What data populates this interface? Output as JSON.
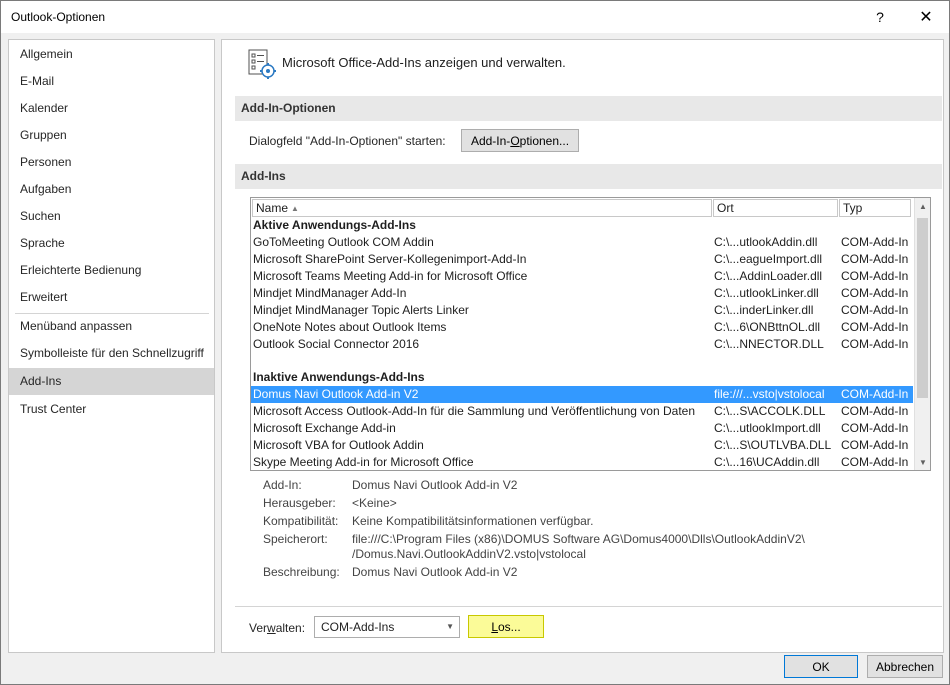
{
  "window": {
    "title": "Outlook-Optionen",
    "help_glyph": "?",
    "close_glyph": "✕"
  },
  "sidebar": {
    "items": [
      {
        "label": "Allgemein"
      },
      {
        "label": "E-Mail"
      },
      {
        "label": "Kalender"
      },
      {
        "label": "Gruppen"
      },
      {
        "label": "Personen"
      },
      {
        "label": "Aufgaben"
      },
      {
        "label": "Suchen"
      },
      {
        "label": "Sprache"
      },
      {
        "label": "Erleichterte Bedienung"
      },
      {
        "label": "Erweitert"
      },
      {
        "label": "Menüband anpassen"
      },
      {
        "label": "Symbolleiste für den Schnellzugriff"
      },
      {
        "label": "Add-Ins",
        "selected": true
      },
      {
        "label": "Trust Center"
      }
    ]
  },
  "main": {
    "header": "Microsoft Office-Add-Ins anzeigen und verwalten.",
    "addin_options_section": "Add-In-Optionen",
    "addin_options_label": "Dialogfeld \"Add-In-Optionen\" starten:",
    "addin_options_button_pre": "Add-In-",
    "addin_options_button_u": "O",
    "addin_options_button_post": "ptionen...",
    "addins_section": "Add-Ins"
  },
  "list": {
    "columns": {
      "name": "Name",
      "ort": "Ort",
      "typ": "Typ"
    },
    "active_group": "Aktive Anwendungs-Add-Ins",
    "active": [
      {
        "name": "GoToMeeting Outlook COM Addin",
        "ort": "C:\\...utlookAddin.dll",
        "typ": "COM-Add-In"
      },
      {
        "name": "Microsoft SharePoint Server-Kollegenimport-Add-In",
        "ort": "C:\\...eagueImport.dll",
        "typ": "COM-Add-In"
      },
      {
        "name": "Microsoft Teams Meeting Add-in for Microsoft Office",
        "ort": "C:\\...AddinLoader.dll",
        "typ": "COM-Add-In"
      },
      {
        "name": "Mindjet MindManager Add-In",
        "ort": "C:\\...utlookLinker.dll",
        "typ": "COM-Add-In"
      },
      {
        "name": "Mindjet MindManager Topic Alerts Linker",
        "ort": "C:\\...inderLinker.dll",
        "typ": "COM-Add-In"
      },
      {
        "name": "OneNote Notes about Outlook Items",
        "ort": "C:\\...6\\ONBttnOL.dll",
        "typ": "COM-Add-In"
      },
      {
        "name": "Outlook Social Connector 2016",
        "ort": "C:\\...NNECTOR.DLL",
        "typ": "COM-Add-In"
      }
    ],
    "inactive_group": "Inaktive Anwendungs-Add-Ins",
    "inactive": [
      {
        "name": "Domus Navi Outlook Add-in V2",
        "ort": "file:///...vsto|vstolocal",
        "typ": "COM-Add-In",
        "selected": true
      },
      {
        "name": "Microsoft Access Outlook-Add-In für die Sammlung und Veröffentlichung von Daten",
        "ort": "C:\\...S\\ACCOLK.DLL",
        "typ": "COM-Add-In"
      },
      {
        "name": "Microsoft Exchange Add-in",
        "ort": "C:\\...utlookImport.dll",
        "typ": "COM-Add-In"
      },
      {
        "name": "Microsoft VBA for Outlook Addin",
        "ort": "C:\\...S\\OUTLVBA.DLL",
        "typ": "COM-Add-In"
      },
      {
        "name": "Skype Meeting Add-in for Microsoft Office",
        "ort": "C:\\...16\\UCAddin.dll",
        "typ": "COM-Add-In"
      }
    ]
  },
  "details": {
    "addin_label": "Add-In:",
    "addin_value": "Domus Navi Outlook Add-in V2",
    "publisher_label": "Herausgeber:",
    "publisher_value": "<Keine>",
    "compat_label": "Kompatibilität:",
    "compat_value": "Keine Kompatibilitätsinformationen verfügbar.",
    "location_label": "Speicherort:",
    "location_value_1": "file:///C:\\Program Files (x86)\\DOMUS Software AG\\Domus4000\\Dlls\\OutlookAddinV2\\",
    "location_value_2": "/Domus.Navi.OutlookAddinV2.vsto|vstolocal",
    "description_label": "Beschreibung:",
    "description_value": "Domus Navi Outlook Add-in V2"
  },
  "manage": {
    "label_pre": "Ver",
    "label_u": "w",
    "label_post": "alten:",
    "selected": "COM-Add-Ins",
    "go_u": "L",
    "go_post": "os..."
  },
  "footer": {
    "ok": "OK",
    "cancel": "Abbrechen"
  },
  "colors": {
    "selection": "#3399ff",
    "highlight_button": "#fbfb98",
    "accent_border": "#0078d7"
  }
}
